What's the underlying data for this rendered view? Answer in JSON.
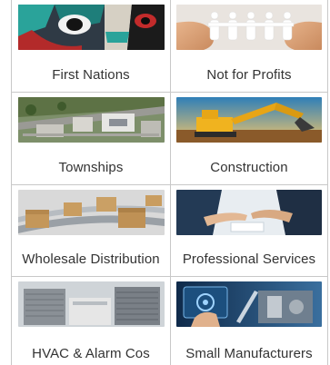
{
  "tiles": [
    {
      "label": "First Nations",
      "image": "totem-pole-art"
    },
    {
      "label": "Not for Profits",
      "image": "hands-holding-paper-people"
    },
    {
      "label": "Townships",
      "image": "aerial-town-view"
    },
    {
      "label": "Construction",
      "image": "excavator-at-sunset"
    },
    {
      "label": "Wholesale Distribution",
      "image": "boxes-on-conveyor"
    },
    {
      "label": "Professional Services",
      "image": "business-handshake"
    },
    {
      "label": "HVAC & Alarm Cos",
      "image": "hvac-units"
    },
    {
      "label": "Small Manufacturers",
      "image": "factory-technology"
    }
  ]
}
